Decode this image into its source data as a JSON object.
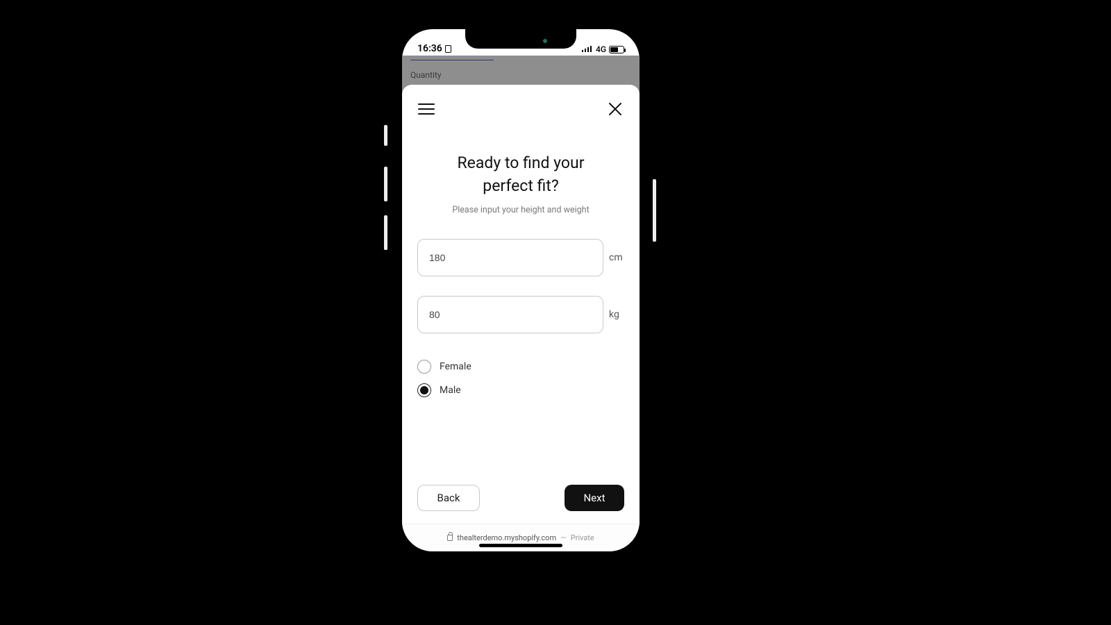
{
  "statusbar": {
    "time": "16:36",
    "network": "4G"
  },
  "background_page": {
    "quantity_label": "Quantity"
  },
  "sheet": {
    "title_line1": "Ready to find your",
    "title_line2": "perfect fit?",
    "subtitle": "Please input your height and weight",
    "height": {
      "value": "180",
      "unit": "cm"
    },
    "weight": {
      "value": "80",
      "unit": "kg"
    },
    "gender": {
      "female_label": "Female",
      "male_label": "Male",
      "selected": "male"
    },
    "back_label": "Back",
    "next_label": "Next"
  },
  "address_bar": {
    "domain": "thealterdemo.myshopify.com",
    "separator": "—",
    "mode": "Private"
  }
}
